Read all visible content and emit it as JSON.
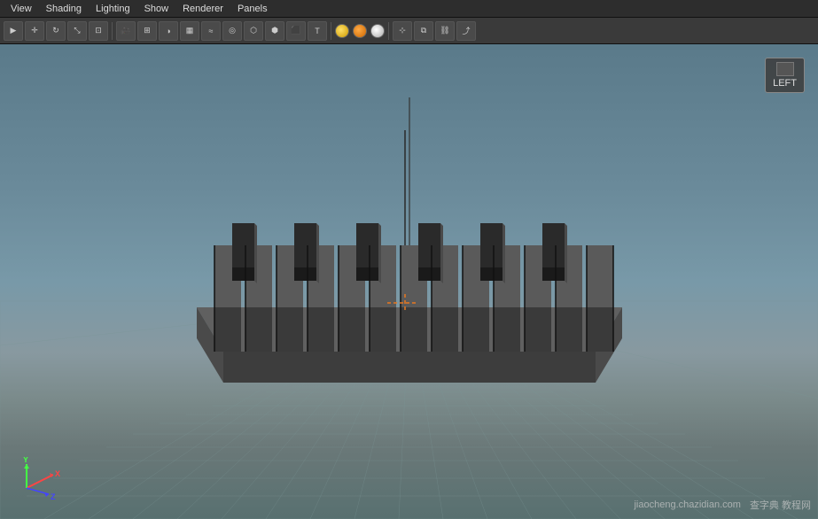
{
  "menu": {
    "items": [
      "View",
      "Shading",
      "Lighting",
      "Show",
      "Renderer",
      "Panels"
    ]
  },
  "toolbar": {
    "buttons": [
      {
        "name": "select",
        "label": "▶"
      },
      {
        "name": "transform",
        "label": "⊕"
      },
      {
        "name": "rotate",
        "label": "↺"
      },
      {
        "name": "scale",
        "label": "⤢"
      },
      {
        "name": "snap",
        "label": "⊡"
      },
      {
        "name": "camera",
        "label": "📷"
      },
      {
        "name": "grid",
        "label": "⊞"
      },
      {
        "name": "render",
        "label": "⬜"
      },
      {
        "name": "shading",
        "label": "◑"
      },
      {
        "name": "texture",
        "label": "▦"
      },
      {
        "name": "smooth",
        "label": "~"
      },
      {
        "name": "isolate",
        "label": "◎"
      },
      {
        "name": "xray",
        "label": "⬡"
      },
      {
        "name": "wire",
        "label": "⬢"
      },
      {
        "name": "solid",
        "label": "⬛"
      },
      {
        "name": "text-t",
        "label": "T"
      }
    ],
    "separator_positions": [
      4,
      8,
      12
    ],
    "circles": [
      {
        "class": "circle-yellow"
      },
      {
        "class": "circle-orange"
      },
      {
        "class": "circle-white"
      }
    ]
  },
  "viewport": {
    "view_label": "LEFT",
    "background_top": "#5a7a8a",
    "background_bottom": "#587070",
    "grid_color": "#6a8888"
  },
  "axis": {
    "x_color": "#ff3333",
    "y_color": "#33ff33",
    "z_color": "#3333ff"
  },
  "watermark": {
    "site": "jiaocheng.chazidian.com",
    "label": "查字典 教程网"
  }
}
